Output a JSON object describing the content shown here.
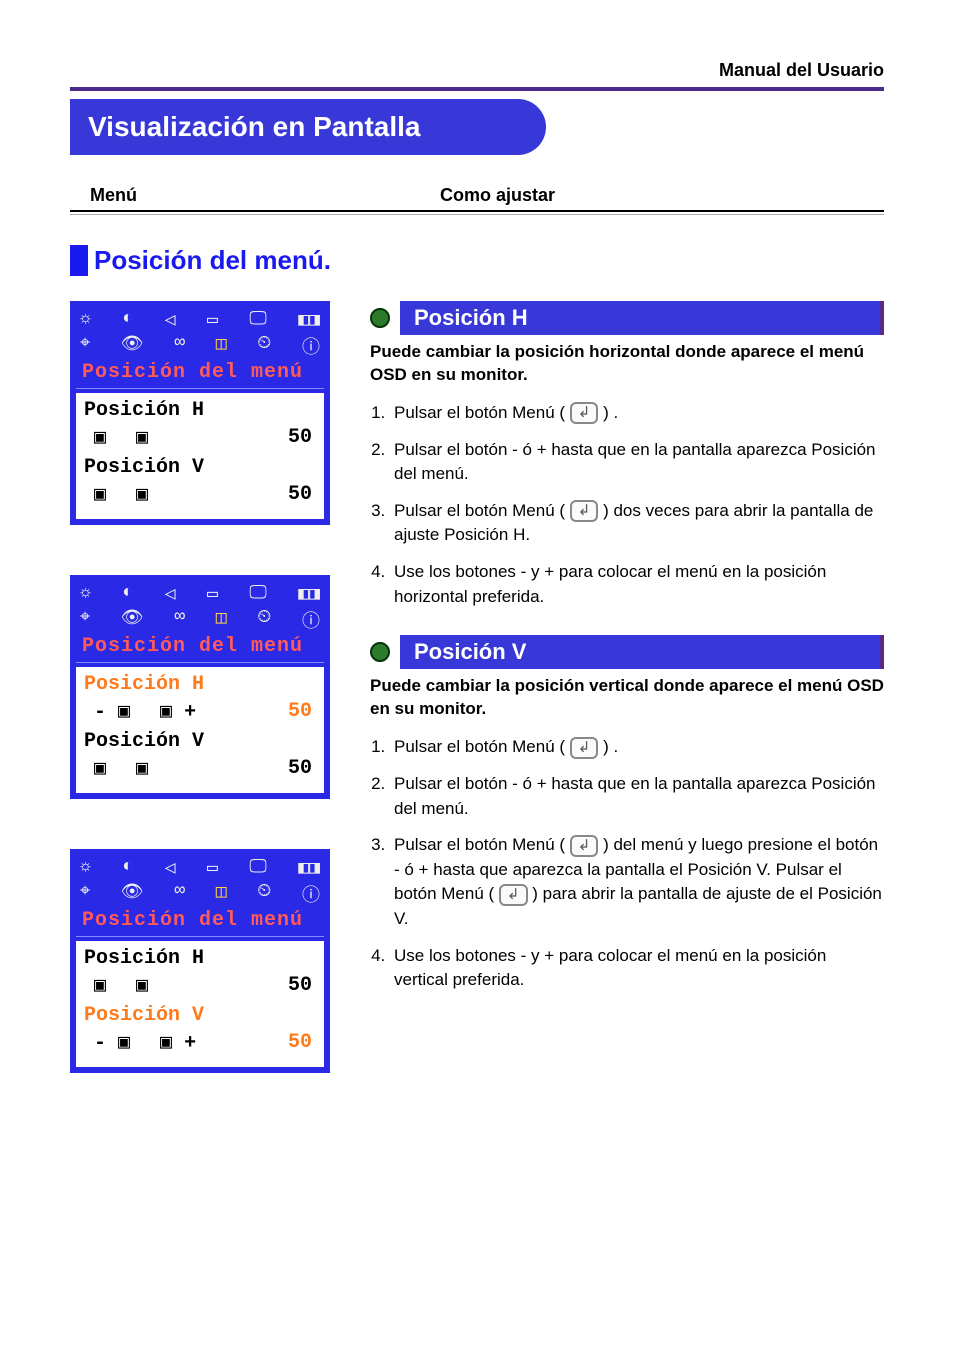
{
  "header": {
    "manual_title": "Manual del Usuario",
    "page_title": "Visualización en Pantalla",
    "col1": "Menú",
    "col2": "Como ajustar"
  },
  "section": {
    "title": "Posición del menú."
  },
  "osd": {
    "title": "Posición del menú",
    "h_label": "Posición H",
    "v_label": "Posición V",
    "val_h": "50",
    "val_v": "50",
    "topicons": [
      "☼",
      "◐",
      "◁",
      "▭",
      "🖵",
      "◧◨"
    ],
    "boticons": [
      "⌖",
      "👁",
      "∞",
      "◫",
      "⏲",
      "ⓘ"
    ]
  },
  "right": {
    "h": {
      "title": "Posición H",
      "intro": "Puede cambiar la posición horizontal donde aparece el menú OSD en su monitor.",
      "steps": [
        {
          "pre": "Pulsar el botón Menú (",
          "post": ") ."
        },
        {
          "text": "Pulsar el botón - ó + hasta que en la pantalla aparezca Posición del menú."
        },
        {
          "pre": "Pulsar el botón Menú (",
          "post": ") dos veces para abrir la pantalla de ajuste Posición H."
        },
        {
          "text": "Use los botones - y + para colocar el menú en la posición horizontal preferida."
        }
      ]
    },
    "v": {
      "title": "Posición V",
      "intro": "Puede cambiar la posición vertical donde aparece el menú OSD en su monitor.",
      "steps": [
        {
          "pre": "Pulsar el botón Menú (",
          "post": ") ."
        },
        {
          "text": "Pulsar el botón - ó + hasta que en la pantalla aparezca Posición del menú."
        },
        {
          "pre1": "Pulsar el botón Menú (",
          "mid": ") del menú y luego presione el botón - ó + hasta que aparezca la pantalla el Posición V. Pulsar el botón Menú (",
          "post": ") para abrir la pantalla de ajuste de el Posición V."
        },
        {
          "text": "Use los botones - y + para colocar el menú en la posición vertical preferida."
        }
      ]
    }
  }
}
